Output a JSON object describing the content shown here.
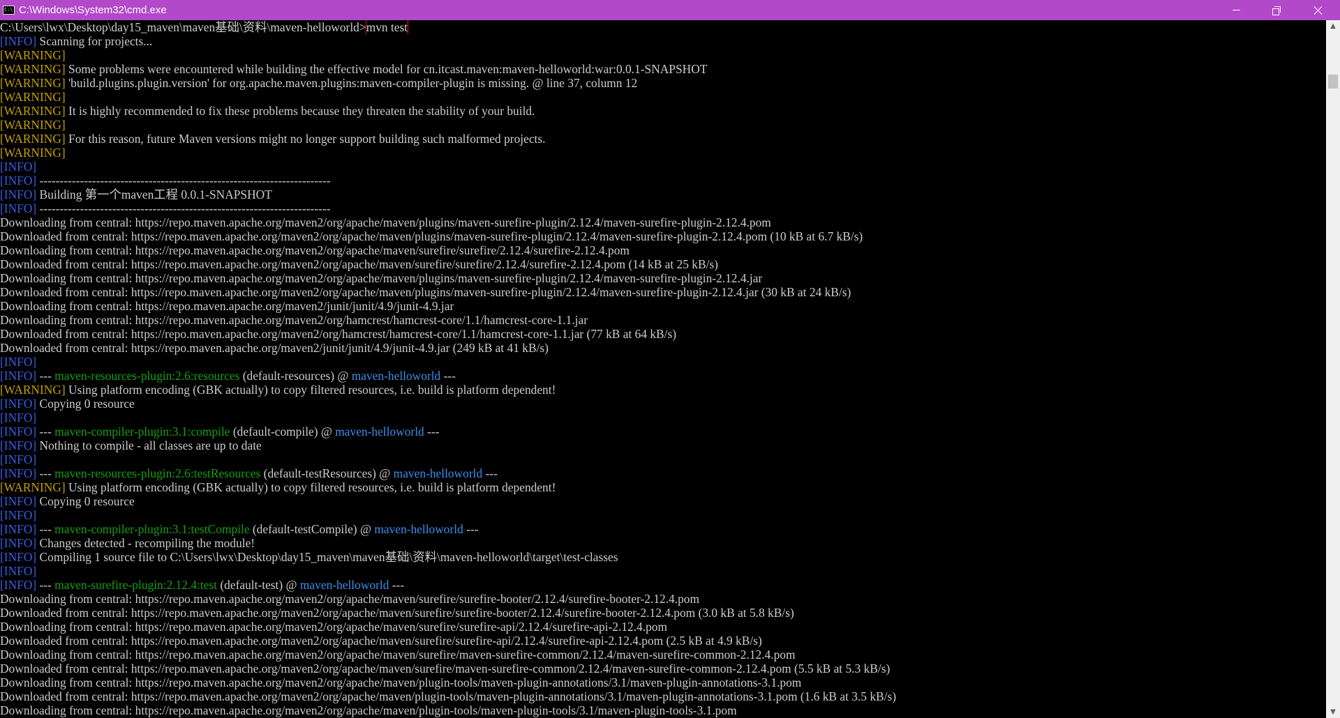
{
  "window": {
    "title": "C:\\Windows\\System32\\cmd.exe",
    "icon_text": "C:\\",
    "buttons": {
      "minimize": "minimize-icon",
      "restore": "restore-icon",
      "close": "close-icon"
    }
  },
  "colors": {
    "titlebar": "#b149c9",
    "info": "#3a5ce0",
    "warning": "#c4a000",
    "plugin": "#13a10e",
    "project": "#3b8eea",
    "text": "#cccccc",
    "highlight_box": "#e81123"
  },
  "console": {
    "prompt": "C:\\Users\\lwx\\Desktop\\day15_maven\\maven基础\\资料\\maven-helloworld>",
    "command": "mvn test",
    "lines": [
      [
        {
          "t": "[INFO]",
          "c": "info"
        },
        {
          "t": " Scanning for projects..."
        }
      ],
      [
        {
          "t": "[WARNING]",
          "c": "warn"
        }
      ],
      [
        {
          "t": "[WARNING]",
          "c": "warn"
        },
        {
          "t": " Some problems were encountered while building the effective model for cn.itcast.maven:maven-helloworld:war:0.0.1-SNAPSHOT"
        }
      ],
      [
        {
          "t": "[WARNING]",
          "c": "warn"
        },
        {
          "t": " 'build.plugins.plugin.version' for org.apache.maven.plugins:maven-compiler-plugin is missing. @ line 37, column 12"
        }
      ],
      [
        {
          "t": "[WARNING]",
          "c": "warn"
        }
      ],
      [
        {
          "t": "[WARNING]",
          "c": "warn"
        },
        {
          "t": " It is highly recommended to fix these problems because they threaten the stability of your build."
        }
      ],
      [
        {
          "t": "[WARNING]",
          "c": "warn"
        }
      ],
      [
        {
          "t": "[WARNING]",
          "c": "warn"
        },
        {
          "t": " For this reason, future Maven versions might no longer support building such malformed projects."
        }
      ],
      [
        {
          "t": "[WARNING]",
          "c": "warn"
        }
      ],
      [
        {
          "t": "[INFO]",
          "c": "info"
        }
      ],
      [
        {
          "t": "[INFO]",
          "c": "info"
        },
        {
          "t": " ------------------------------------------------------------------------"
        }
      ],
      [
        {
          "t": "[INFO]",
          "c": "info"
        },
        {
          "t": " Building 第一个maven工程 0.0.1-SNAPSHOT"
        }
      ],
      [
        {
          "t": "[INFO]",
          "c": "info"
        },
        {
          "t": " ------------------------------------------------------------------------"
        }
      ],
      [
        {
          "t": "Downloading from central: https://repo.maven.apache.org/maven2/org/apache/maven/plugins/maven-surefire-plugin/2.12.4/maven-surefire-plugin-2.12.4.pom"
        }
      ],
      [
        {
          "t": "Downloaded from central: https://repo.maven.apache.org/maven2/org/apache/maven/plugins/maven-surefire-plugin/2.12.4/maven-surefire-plugin-2.12.4.pom (10 kB at 6.7 kB/s)"
        }
      ],
      [
        {
          "t": "Downloading from central: https://repo.maven.apache.org/maven2/org/apache/maven/surefire/surefire/2.12.4/surefire-2.12.4.pom"
        }
      ],
      [
        {
          "t": "Downloaded from central: https://repo.maven.apache.org/maven2/org/apache/maven/surefire/surefire/2.12.4/surefire-2.12.4.pom (14 kB at 25 kB/s)"
        }
      ],
      [
        {
          "t": "Downloading from central: https://repo.maven.apache.org/maven2/org/apache/maven/plugins/maven-surefire-plugin/2.12.4/maven-surefire-plugin-2.12.4.jar"
        }
      ],
      [
        {
          "t": "Downloaded from central: https://repo.maven.apache.org/maven2/org/apache/maven/plugins/maven-surefire-plugin/2.12.4/maven-surefire-plugin-2.12.4.jar (30 kB at 24 kB/s)"
        }
      ],
      [
        {
          "t": "Downloading from central: https://repo.maven.apache.org/maven2/junit/junit/4.9/junit-4.9.jar"
        }
      ],
      [
        {
          "t": "Downloading from central: https://repo.maven.apache.org/maven2/org/hamcrest/hamcrest-core/1.1/hamcrest-core-1.1.jar"
        }
      ],
      [
        {
          "t": "Downloaded from central: https://repo.maven.apache.org/maven2/org/hamcrest/hamcrest-core/1.1/hamcrest-core-1.1.jar (77 kB at 64 kB/s)"
        }
      ],
      [
        {
          "t": "Downloaded from central: https://repo.maven.apache.org/maven2/junit/junit/4.9/junit-4.9.jar (249 kB at 41 kB/s)"
        }
      ],
      [
        {
          "t": "[INFO]",
          "c": "info"
        }
      ],
      [
        {
          "t": "[INFO]",
          "c": "info"
        },
        {
          "t": " --- "
        },
        {
          "t": "maven-resources-plugin:2.6:resources",
          "c": "plugin"
        },
        {
          "t": " (default-resources) @ "
        },
        {
          "t": "maven-helloworld",
          "c": "project"
        },
        {
          "t": " ---"
        }
      ],
      [
        {
          "t": "[WARNING]",
          "c": "warn"
        },
        {
          "t": " Using platform encoding (GBK actually) to copy filtered resources, i.e. build is platform dependent!"
        }
      ],
      [
        {
          "t": "[INFO]",
          "c": "info"
        },
        {
          "t": " Copying 0 resource"
        }
      ],
      [
        {
          "t": "[INFO]",
          "c": "info"
        }
      ],
      [
        {
          "t": "[INFO]",
          "c": "info"
        },
        {
          "t": " --- "
        },
        {
          "t": "maven-compiler-plugin:3.1:compile",
          "c": "plugin"
        },
        {
          "t": " (default-compile) @ "
        },
        {
          "t": "maven-helloworld",
          "c": "project"
        },
        {
          "t": " ---"
        }
      ],
      [
        {
          "t": "[INFO]",
          "c": "info"
        },
        {
          "t": " Nothing to compile - all classes are up to date"
        }
      ],
      [
        {
          "t": "[INFO]",
          "c": "info"
        }
      ],
      [
        {
          "t": "[INFO]",
          "c": "info"
        },
        {
          "t": " --- "
        },
        {
          "t": "maven-resources-plugin:2.6:testResources",
          "c": "plugin"
        },
        {
          "t": " (default-testResources) @ "
        },
        {
          "t": "maven-helloworld",
          "c": "project"
        },
        {
          "t": " ---"
        }
      ],
      [
        {
          "t": "[WARNING]",
          "c": "warn"
        },
        {
          "t": " Using platform encoding (GBK actually) to copy filtered resources, i.e. build is platform dependent!"
        }
      ],
      [
        {
          "t": "[INFO]",
          "c": "info"
        },
        {
          "t": " Copying 0 resource"
        }
      ],
      [
        {
          "t": "[INFO]",
          "c": "info"
        }
      ],
      [
        {
          "t": "[INFO]",
          "c": "info"
        },
        {
          "t": " --- "
        },
        {
          "t": "maven-compiler-plugin:3.1:testCompile",
          "c": "plugin"
        },
        {
          "t": " (default-testCompile) @ "
        },
        {
          "t": "maven-helloworld",
          "c": "project"
        },
        {
          "t": " ---"
        }
      ],
      [
        {
          "t": "[INFO]",
          "c": "info"
        },
        {
          "t": " Changes detected - recompiling the module!"
        }
      ],
      [
        {
          "t": "[INFO]",
          "c": "info"
        },
        {
          "t": " Compiling 1 source file to C:\\Users\\lwx\\Desktop\\day15_maven\\maven基础\\资料\\maven-helloworld\\target\\test-classes"
        }
      ],
      [
        {
          "t": "[INFO]",
          "c": "info"
        }
      ],
      [
        {
          "t": "[INFO]",
          "c": "info"
        },
        {
          "t": " --- "
        },
        {
          "t": "maven-surefire-plugin:2.12.4:test",
          "c": "plugin"
        },
        {
          "t": " (default-test) @ "
        },
        {
          "t": "maven-helloworld",
          "c": "project"
        },
        {
          "t": " ---"
        }
      ],
      [
        {
          "t": "Downloading from central: https://repo.maven.apache.org/maven2/org/apache/maven/surefire/surefire-booter/2.12.4/surefire-booter-2.12.4.pom"
        }
      ],
      [
        {
          "t": "Downloaded from central: https://repo.maven.apache.org/maven2/org/apache/maven/surefire/surefire-booter/2.12.4/surefire-booter-2.12.4.pom (3.0 kB at 5.8 kB/s)"
        }
      ],
      [
        {
          "t": "Downloading from central: https://repo.maven.apache.org/maven2/org/apache/maven/surefire/surefire-api/2.12.4/surefire-api-2.12.4.pom"
        }
      ],
      [
        {
          "t": "Downloaded from central: https://repo.maven.apache.org/maven2/org/apache/maven/surefire/surefire-api/2.12.4/surefire-api-2.12.4.pom (2.5 kB at 4.9 kB/s)"
        }
      ],
      [
        {
          "t": "Downloading from central: https://repo.maven.apache.org/maven2/org/apache/maven/surefire/maven-surefire-common/2.12.4/maven-surefire-common-2.12.4.pom"
        }
      ],
      [
        {
          "t": "Downloaded from central: https://repo.maven.apache.org/maven2/org/apache/maven/surefire/maven-surefire-common/2.12.4/maven-surefire-common-2.12.4.pom (5.5 kB at 5.3 kB/s)"
        }
      ],
      [
        {
          "t": "Downloading from central: https://repo.maven.apache.org/maven2/org/apache/maven/plugin-tools/maven-plugin-annotations/3.1/maven-plugin-annotations-3.1.pom"
        }
      ],
      [
        {
          "t": "Downloaded from central: https://repo.maven.apache.org/maven2/org/apache/maven/plugin-tools/maven-plugin-annotations/3.1/maven-plugin-annotations-3.1.pom (1.6 kB at 3.5 kB/s)"
        }
      ],
      [
        {
          "t": "Downloading from central: https://repo.maven.apache.org/maven2/org/apache/maven/plugin-tools/maven-plugin-tools/3.1/maven-plugin-tools-3.1.pom"
        }
      ]
    ]
  },
  "scrollbar": {
    "up_arrow": "▲",
    "down_arrow": "▼"
  }
}
